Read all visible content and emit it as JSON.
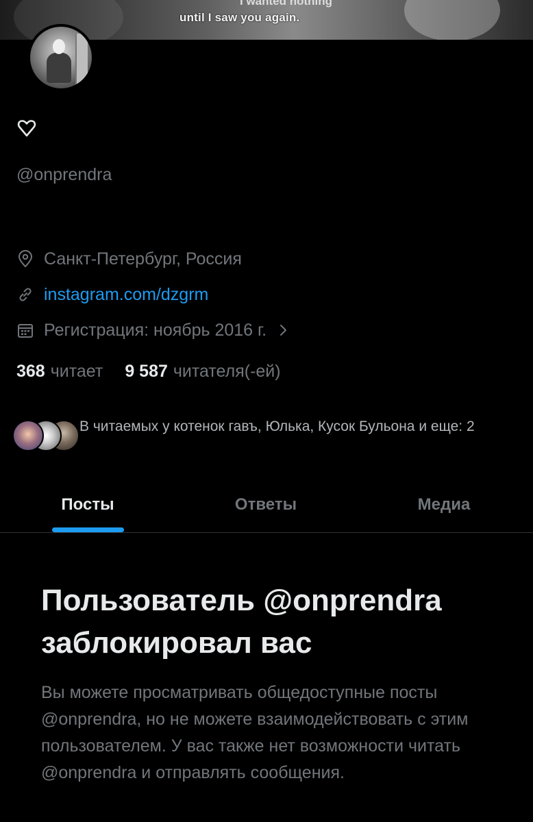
{
  "banner": {
    "caption_top": "I wanted nothing",
    "caption": "until I saw you again."
  },
  "profile": {
    "display_name_icon": "heart-outline-icon",
    "handle": "@onprendra",
    "location": "Санкт-Петербург, Россия",
    "website": "instagram.com/dzgrm",
    "joined": "Регистрация: ноябрь 2016 г.",
    "icons": {
      "location": "map-pin-icon",
      "website": "link-icon",
      "joined": "calendar-icon"
    }
  },
  "stats": {
    "following_count": "368",
    "following_label": "читает",
    "followers_count": "9 587",
    "followers_label": "читателя(-ей)"
  },
  "followers_you_know": {
    "text": "В читаемых у котенок гавъ, Юлька, Кусок Бульона и еще: 2"
  },
  "tabs": [
    {
      "label": "Посты",
      "active": true
    },
    {
      "label": "Ответы",
      "active": false
    },
    {
      "label": "Медиа",
      "active": false
    }
  ],
  "blocked_notice": {
    "title": "Пользователь @onprendra заблокировал вас",
    "body": "Вы можете просматривать общедоступные посты @onprendra, но не можете взаимодействовать с этим пользователем. У вас также нет возможности читать @onprendra и отправлять сообщения."
  },
  "colors": {
    "background": "#000000",
    "accent": "#1d9bf0",
    "text_primary": "#e7e9ea",
    "text_secondary": "#71767b"
  }
}
